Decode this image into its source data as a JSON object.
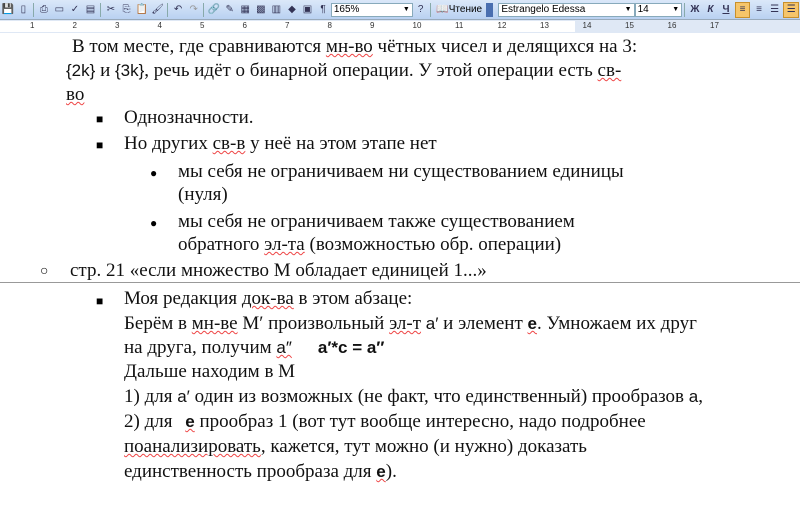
{
  "toolbar": {
    "zoom": "165%",
    "reading_label": "Чтение",
    "font_name": "Estrangelo Edessa",
    "font_size": "14",
    "bold": "Ж",
    "italic": "К",
    "underline": "Ч",
    "pilcrow": "¶"
  },
  "ruler": {
    "ticks": [
      "1",
      "2",
      "3",
      "4",
      "5",
      "6",
      "7",
      "8",
      "9",
      "10",
      "11",
      "12",
      "13",
      "14",
      "15",
      "16",
      "17"
    ]
  },
  "doc": {
    "l1": "В том месте, где сравниваются ",
    "l1u": "мн-во",
    "l1b": " чётных чисел и делящихся на 3:",
    "l2a": "{2k}",
    "l2b": " и ",
    "l2c": "{3k}",
    "l2d": ", речь идёт о бинарной операции. У этой операции есть ",
    "l2e": "св-",
    "l3": "во",
    "l4": "Однозначности.",
    "l5a": "Но других ",
    "l5b": "св-в",
    "l5c": " у неё на этом этапе нет",
    "l6": "мы себя не ограничиваем ни существованием единицы",
    "l7": "(нуля)",
    "l8": "мы себя не ограничиваем также существованием",
    "l9a": "обратного ",
    "l9b": "эл-та",
    "l9c": " (возможностью обр. операции)",
    "l10": "стр. 21 «если множество М обладает единицей 1...»",
    "l11a": "Моя редакция ",
    "l11b": "док-ва",
    "l11c": " в этом абзаце:",
    "l12a": "Берём в ",
    "l12b": "мн-ве",
    "l12c": " М′ произвольный ",
    "l12d": "эл-т",
    "l12e": " ",
    "l12f": "a′",
    "l12g": " и элемент ",
    "l12h": "e",
    "l12i": ". Умножаем их друг",
    "l13a": "на друга, получим ",
    "l13b": "a″",
    "l13c": "a′*c = a″",
    "l14": "Дальше находим в М",
    "l15a": "1) для ",
    "l15b": "a′",
    "l15c": " один из возможных (не факт, что единственный) прообразов ",
    "l15d": "a",
    ",": ",",
    "l16a": "2) для ",
    "l16b": "e",
    "l16c": " прообраз 1 (вот тут вообще интересно, надо подробнее",
    "l17a": "поанализировать",
    "l17b": ", кажется, тут можно (и нужно) доказать",
    "l18a": "единственность прообраза для ",
    "l18b": "e",
    "l18c": ")."
  }
}
